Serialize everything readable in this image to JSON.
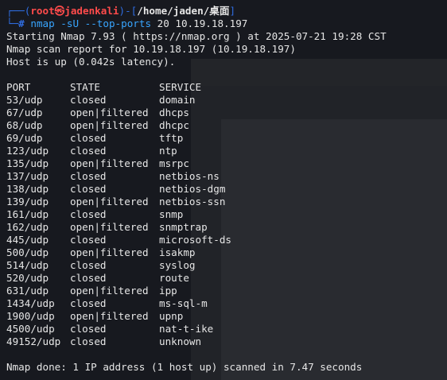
{
  "prompt": {
    "frame_top": "┌──(",
    "user_host": "root㉿jadenkali",
    "frame_mid": ")-[",
    "cwd": "/home/jaden/桌面",
    "frame_end": "]",
    "frame_bottom": "└─",
    "symbol": "#",
    "command": "nmap",
    "flags": "-sU --top-ports",
    "args": "20 10.19.18.197"
  },
  "output": {
    "start_line": "Starting Nmap 7.93 ( https://nmap.org ) at 2025-07-21 19:28 CST",
    "report_line": "Nmap scan report for 10.19.18.197 (10.19.18.197)",
    "host_line": "Host is up (0.042s latency).",
    "done_line": "Nmap done: 1 IP address (1 host up) scanned in 7.47 seconds"
  },
  "table": {
    "headers": [
      "PORT",
      "STATE",
      "SERVICE"
    ],
    "rows": [
      [
        "53/udp",
        "closed",
        "domain"
      ],
      [
        "67/udp",
        "open|filtered",
        "dhcps"
      ],
      [
        "68/udp",
        "open|filtered",
        "dhcpc"
      ],
      [
        "69/udp",
        "closed",
        "tftp"
      ],
      [
        "123/udp",
        "closed",
        "ntp"
      ],
      [
        "135/udp",
        "open|filtered",
        "msrpc"
      ],
      [
        "137/udp",
        "closed",
        "netbios-ns"
      ],
      [
        "138/udp",
        "closed",
        "netbios-dgm"
      ],
      [
        "139/udp",
        "open|filtered",
        "netbios-ssn"
      ],
      [
        "161/udp",
        "closed",
        "snmp"
      ],
      [
        "162/udp",
        "open|filtered",
        "snmptrap"
      ],
      [
        "445/udp",
        "closed",
        "microsoft-ds"
      ],
      [
        "500/udp",
        "open|filtered",
        "isakmp"
      ],
      [
        "514/udp",
        "closed",
        "syslog"
      ],
      [
        "520/udp",
        "closed",
        "route"
      ],
      [
        "631/udp",
        "open|filtered",
        "ipp"
      ],
      [
        "1434/udp",
        "closed",
        "ms-sql-m"
      ],
      [
        "1900/udp",
        "open|filtered",
        "upnp"
      ],
      [
        "4500/udp",
        "closed",
        "nat-t-ike"
      ],
      [
        "49152/udp",
        "closed",
        "unknown"
      ]
    ]
  },
  "colors": {
    "background": "#17191f",
    "text": "#e6e6e6",
    "prompt_frame": "#2f6de1",
    "prompt_user": "#ff4b4b",
    "command": "#38a5ff"
  }
}
